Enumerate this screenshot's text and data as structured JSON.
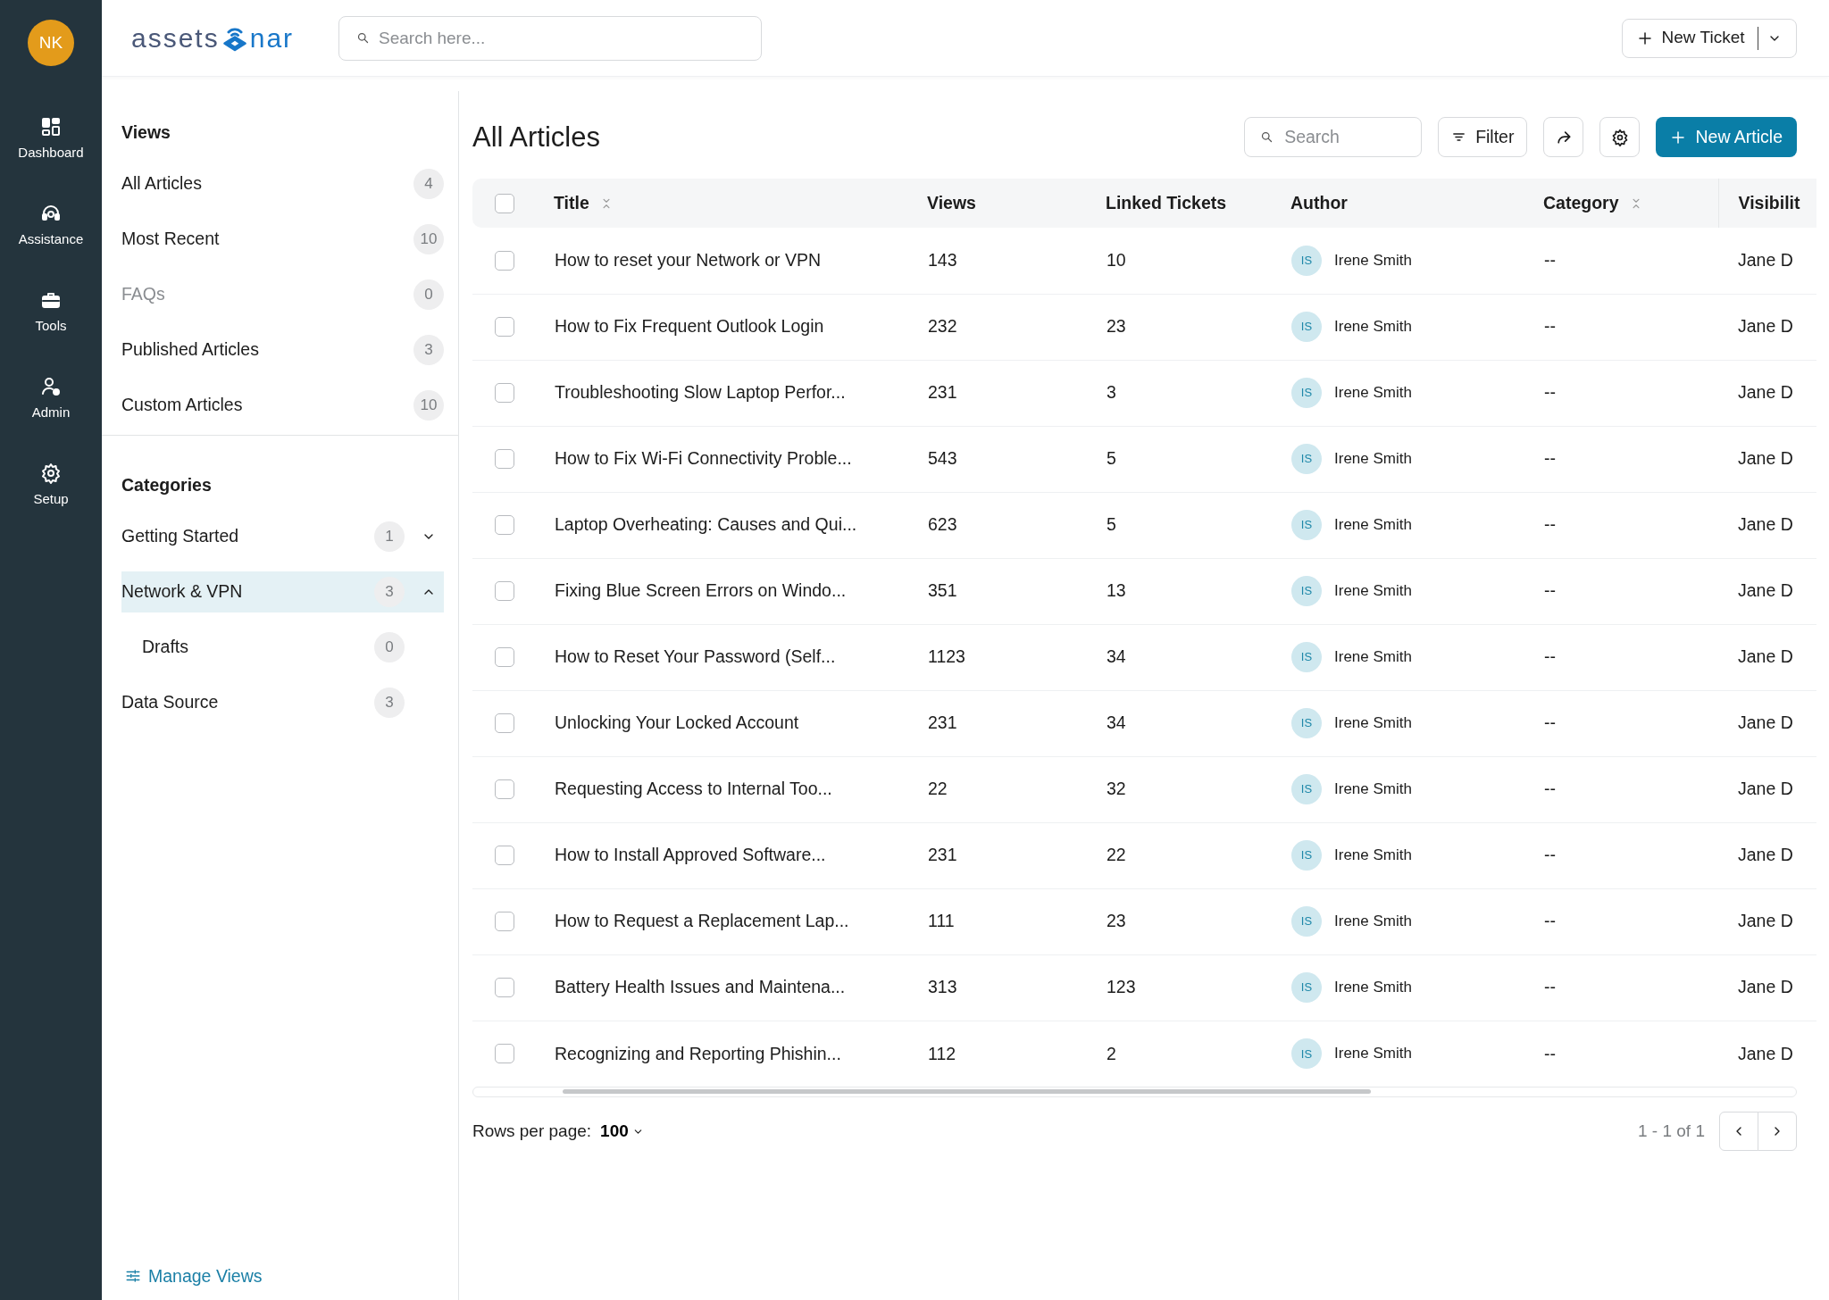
{
  "rail": {
    "avatar": "NK",
    "items": [
      {
        "label": "Dashboard"
      },
      {
        "label": "Assistance"
      },
      {
        "label": "Tools"
      },
      {
        "label": "Admin"
      },
      {
        "label": "Setup"
      }
    ]
  },
  "header": {
    "logo": [
      "assets",
      "nar"
    ],
    "search": {
      "placeholder": "Search here..."
    },
    "new_ticket": "New Ticket"
  },
  "sidebar": {
    "views_heading": "Views",
    "views": [
      {
        "label": "All Articles",
        "count": "4",
        "disabled": false,
        "selected": false
      },
      {
        "label": "Most Recent",
        "count": "10",
        "disabled": false,
        "selected": false
      },
      {
        "label": "FAQs",
        "count": "0",
        "disabled": true,
        "selected": false
      },
      {
        "label": "Published Articles",
        "count": "3",
        "disabled": false,
        "selected": false
      },
      {
        "label": "Custom Articles",
        "count": "10",
        "disabled": false,
        "selected": false
      }
    ],
    "categories_heading": "Categories",
    "categories": [
      {
        "label": "Getting Started",
        "count": "1",
        "selected": false,
        "expanded": false
      },
      {
        "label": "Network & VPN",
        "count": "3",
        "selected": true,
        "expanded": true,
        "children": [
          {
            "label": "Drafts",
            "count": "0",
            "selected": false
          }
        ]
      },
      {
        "label": "Data Source",
        "count": "3",
        "selected": false
      }
    ],
    "manage_views": "Manage Views"
  },
  "main": {
    "title": "All Articles",
    "search": {
      "placeholder": "Search"
    },
    "filter": "Filter",
    "new_article": "New Article",
    "table": {
      "select_all_checked": false,
      "columns": [
        {
          "label": "Title",
          "sortable": true
        },
        {
          "label": "Views",
          "sortable": false
        },
        {
          "label": "Linked Tickets",
          "sortable": false
        },
        {
          "label": "Author",
          "sortable": false
        },
        {
          "label": "Category",
          "sortable": true
        },
        {
          "label": "Visibilit",
          "sortable": false
        }
      ],
      "rows": [
        {
          "checked": false,
          "title": "How to reset your Network or VPN",
          "views": "143",
          "linked_tickets": "10",
          "author_initials": "IS",
          "author": "Irene Smith",
          "category": "--",
          "visibility": "Jane D"
        },
        {
          "checked": false,
          "title": "How to Fix Frequent Outlook Login",
          "views": "232",
          "linked_tickets": "23",
          "author_initials": "IS",
          "author": "Irene Smith",
          "category": "--",
          "visibility": "Jane D"
        },
        {
          "checked": false,
          "title": "Troubleshooting Slow Laptop Perfor...",
          "views": "231",
          "linked_tickets": "3",
          "author_initials": "IS",
          "author": "Irene Smith",
          "category": "--",
          "visibility": "Jane D"
        },
        {
          "checked": false,
          "title": "How to Fix Wi-Fi Connectivity Proble...",
          "views": "543",
          "linked_tickets": "5",
          "author_initials": "IS",
          "author": "Irene Smith",
          "category": "--",
          "visibility": "Jane D"
        },
        {
          "checked": false,
          "title": "Laptop Overheating: Causes and Qui...",
          "views": "623",
          "linked_tickets": "5",
          "author_initials": "IS",
          "author": "Irene Smith",
          "category": "--",
          "visibility": "Jane D"
        },
        {
          "checked": false,
          "title": "Fixing Blue Screen Errors on Windo...",
          "views": "351",
          "linked_tickets": "13",
          "author_initials": "IS",
          "author": "Irene Smith",
          "category": "--",
          "visibility": "Jane D"
        },
        {
          "checked": false,
          "title": "How to Reset Your Password (Self...",
          "views": "1123",
          "linked_tickets": "34",
          "author_initials": "IS",
          "author": "Irene Smith",
          "category": "--",
          "visibility": "Jane D"
        },
        {
          "checked": false,
          "title": "Unlocking Your Locked Account",
          "views": "231",
          "linked_tickets": "34",
          "author_initials": "IS",
          "author": "Irene Smith",
          "category": "--",
          "visibility": "Jane D"
        },
        {
          "checked": false,
          "title": "Requesting Access to Internal Too...",
          "views": "22",
          "linked_tickets": "32",
          "author_initials": "IS",
          "author": "Irene Smith",
          "category": "--",
          "visibility": "Jane D"
        },
        {
          "checked": false,
          "title": "How to Install Approved Software...",
          "views": "231",
          "linked_tickets": "22",
          "author_initials": "IS",
          "author": "Irene Smith",
          "category": "--",
          "visibility": "Jane D"
        },
        {
          "checked": false,
          "title": "How to Request a Replacement Lap...",
          "views": "111",
          "linked_tickets": "23",
          "author_initials": "IS",
          "author": "Irene Smith",
          "category": "--",
          "visibility": "Jane D"
        },
        {
          "checked": false,
          "title": "Battery Health Issues and Maintena...",
          "views": "313",
          "linked_tickets": "123",
          "author_initials": "IS",
          "author": "Irene Smith",
          "category": "--",
          "visibility": "Jane D"
        },
        {
          "checked": false,
          "title": "Recognizing and Reporting Phishin...",
          "views": "112",
          "linked_tickets": "2",
          "author_initials": "IS",
          "author": "Irene Smith",
          "category": "--",
          "visibility": "Jane D"
        }
      ]
    },
    "footer": {
      "rows_per_page_label": "Rows per page:",
      "rows_per_page": "100",
      "range": "1 - 1 of 1"
    }
  }
}
